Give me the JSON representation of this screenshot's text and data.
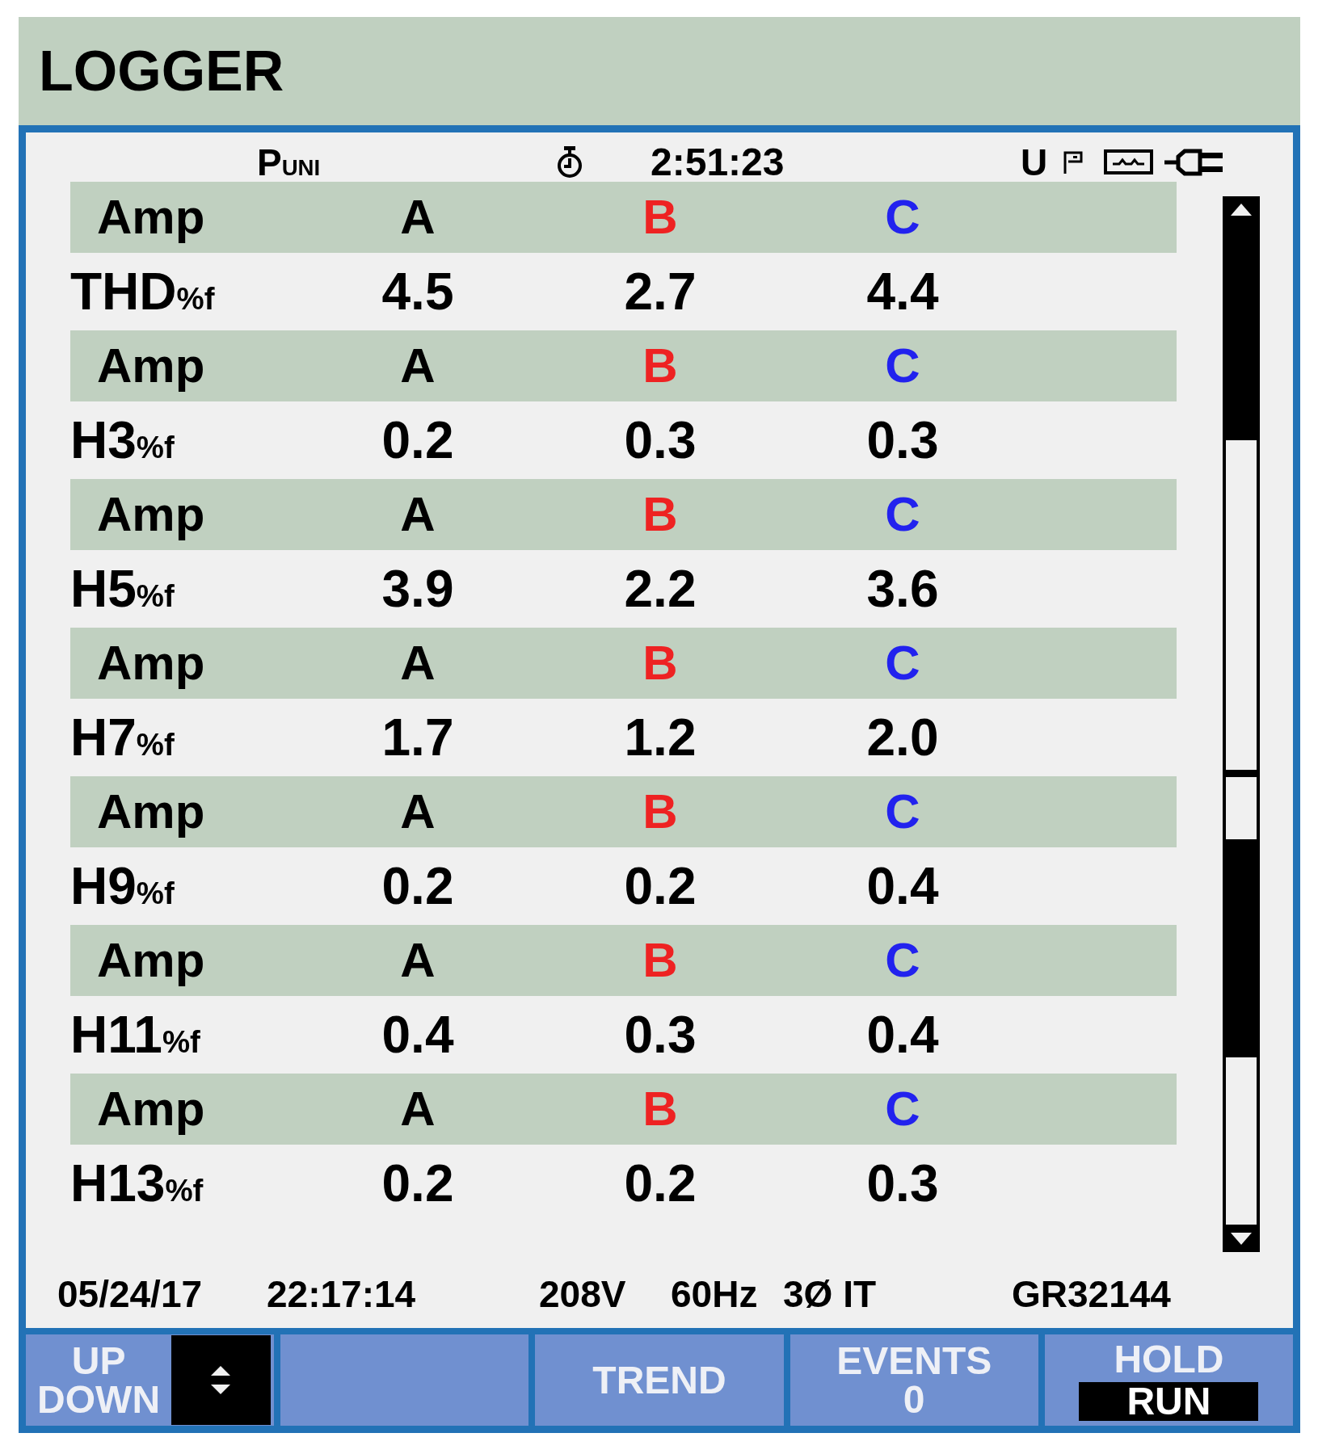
{
  "screen": {
    "title": "LOGGER"
  },
  "status_bar": {
    "mode": "P$_{UNI}$",
    "elapsed_time": "2:51:23",
    "indicator": "U"
  },
  "table": {
    "blocks": [
      {
        "header": {
          "unit": "Amp",
          "phases": [
            {
              "label": "A",
              "color": "#000000"
            },
            {
              "label": "B",
              "color": "#ee2222"
            },
            {
              "label": "C",
              "color": "#2222ee"
            }
          ]
        },
        "row": {
          "name": "THD$_{%f}$",
          "values": [
            "4.5",
            "2.7",
            "4.4"
          ]
        }
      },
      {
        "header": {
          "unit": "Amp",
          "phases": [
            {
              "label": "A",
              "color": "#000000"
            },
            {
              "label": "B",
              "color": "#ee2222"
            },
            {
              "label": "C",
              "color": "#2222ee"
            }
          ]
        },
        "row": {
          "name": "H3$_{%f}$",
          "values": [
            "0.2",
            "0.3",
            "0.3"
          ]
        }
      },
      {
        "header": {
          "unit": "Amp",
          "phases": [
            {
              "label": "A",
              "color": "#000000"
            },
            {
              "label": "B",
              "color": "#ee2222"
            },
            {
              "label": "C",
              "color": "#2222ee"
            }
          ]
        },
        "row": {
          "name": "H5$_{%f}$",
          "values": [
            "3.9",
            "2.2",
            "3.6"
          ]
        }
      },
      {
        "header": {
          "unit": "Amp",
          "phases": [
            {
              "label": "A",
              "color": "#000000"
            },
            {
              "label": "B",
              "color": "#ee2222"
            },
            {
              "label": "C",
              "color": "#2222ee"
            }
          ]
        },
        "row": {
          "name": "H7$_{%f}$",
          "values": [
            "1.7",
            "1.2",
            "2.0"
          ]
        }
      },
      {
        "header": {
          "unit": "Amp",
          "phases": [
            {
              "label": "A",
              "color": "#000000"
            },
            {
              "label": "B",
              "color": "#ee2222"
            },
            {
              "label": "C",
              "color": "#2222ee"
            }
          ]
        },
        "row": {
          "name": "H9$_{%f}$",
          "values": [
            "0.2",
            "0.2",
            "0.4"
          ]
        }
      },
      {
        "header": {
          "unit": "Amp",
          "phases": [
            {
              "label": "A",
              "color": "#000000"
            },
            {
              "label": "B",
              "color": "#ee2222"
            },
            {
              "label": "C",
              "color": "#2222ee"
            }
          ]
        },
        "row": {
          "name": "H11$_{%f}$",
          "values": [
            "0.4",
            "0.3",
            "0.4"
          ]
        }
      },
      {
        "header": {
          "unit": "Amp",
          "phases": [
            {
              "label": "A",
              "color": "#000000"
            },
            {
              "label": "B",
              "color": "#ee2222"
            },
            {
              "label": "C",
              "color": "#2222ee"
            }
          ]
        },
        "row": {
          "name": "H13$_{%f}$",
          "values": [
            "0.2",
            "0.2",
            "0.3"
          ]
        }
      }
    ]
  },
  "footer": {
    "date": "05/24/17",
    "time": "22:17:14",
    "voltage": "208V",
    "frequency": "60Hz",
    "config": "3Ø IT",
    "id": "GR32144"
  },
  "softkeys": [
    {
      "kind": "updown",
      "lines": [
        "UP",
        "DOWN"
      ]
    },
    {
      "kind": "blank"
    },
    {
      "kind": "label",
      "lines": [
        "TREND"
      ]
    },
    {
      "kind": "label",
      "lines": [
        "EVENTS",
        "0"
      ]
    },
    {
      "kind": "toggle",
      "options": [
        {
          "label": "HOLD",
          "selected": false
        },
        {
          "label": "RUN",
          "selected": true
        }
      ]
    }
  ]
}
